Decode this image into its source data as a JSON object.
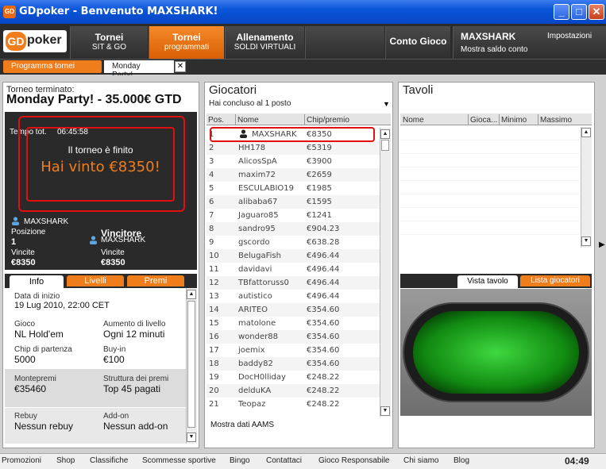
{
  "window": {
    "title": "GDpoker - Benvenuto MAXSHARK!",
    "app_icon": "GD"
  },
  "logo": {
    "gd": "GD",
    "poker": "poker"
  },
  "nav": [
    {
      "l1": "Tornei",
      "l2": "SIT & GO"
    },
    {
      "l1": "Tornei",
      "l2": "programmati"
    },
    {
      "l1": "Allenamento",
      "l2": "SOLDI VIRTUALI"
    },
    {
      "l1": "Conto Gioco",
      "l2": ""
    }
  ],
  "account": {
    "user": "MAXSHARK",
    "settings": "Impostazioni",
    "show_balance": "Mostra saldo conto"
  },
  "subtabs": {
    "schedule": "Programma tornei",
    "current": "Monday Party!..."
  },
  "left": {
    "status": "Torneo terminato:",
    "name": "Monday Party! - 35.000€ GTD",
    "time_label": "Tempo tot.",
    "time_value": "06:45:58",
    "finished": "Il torneo è finito",
    "won": "Hai vinto €8350!",
    "player": "MAXSHARK",
    "position_label": "Posizione",
    "position_value": "1",
    "winnings_label": "Vincite",
    "winnings_value": "€8350",
    "winner_label": "Vincitore",
    "winner_name": "MAXSHARK",
    "winner_winnings_label": "Vincite",
    "winner_winnings_value": "€8350",
    "tabs": [
      "Info",
      "Livelli",
      "Premi"
    ],
    "info": {
      "start_label": "Data di inizio",
      "start_value": "19 Lug 2010, 22:00 CET",
      "game_label": "Gioco",
      "game_value": "NL Hold'em",
      "level_label": "Aumento di livello",
      "level_value": "Ogni 12 minuti",
      "chips_label": "Chip di partenza",
      "chips_value": "5000",
      "buyin_label": "Buy-in",
      "buyin_value": "€100",
      "prize_label": "Montepremi",
      "prize_value": "€35460",
      "structure_label": "Struttura dei premi",
      "structure_value": "Top 45 pagati",
      "rebuy_label": "Rebuy",
      "rebuy_value": "Nessun rebuy",
      "addon_label": "Add-on",
      "addon_value": "Nessun add-on"
    }
  },
  "players": {
    "title": "Giocatori",
    "filter": "Hai concluso al 1 posto",
    "columns": [
      "Pos.",
      "Nome",
      "Chip/premio"
    ],
    "rows": [
      [
        "1",
        "MAXSHARK",
        "€8350"
      ],
      [
        "2",
        "HH178",
        "€5319"
      ],
      [
        "3",
        "AlicosSpA",
        "€3900"
      ],
      [
        "4",
        "maxim72",
        "€2659"
      ],
      [
        "5",
        "ESCULABIO19",
        "€1985"
      ],
      [
        "6",
        "alibaba67",
        "€1595"
      ],
      [
        "7",
        "Jaguaro85",
        "€1241"
      ],
      [
        "8",
        "sandro95",
        "€904.23"
      ],
      [
        "9",
        "gscordo",
        "€638.28"
      ],
      [
        "10",
        "BelugaFish",
        "€496.44"
      ],
      [
        "11",
        "davidavi",
        "€496.44"
      ],
      [
        "12",
        "TBfattoruss0",
        "€496.44"
      ],
      [
        "13",
        "autistico",
        "€496.44"
      ],
      [
        "14",
        "ARITEO",
        "€354.60"
      ],
      [
        "15",
        "matolone",
        "€354.60"
      ],
      [
        "16",
        "wonder88",
        "€354.60"
      ],
      [
        "17",
        "joemix",
        "€354.60"
      ],
      [
        "18",
        "baddy82",
        "€354.60"
      ],
      [
        "19",
        "DocH0lliday",
        "€248.22"
      ],
      [
        "20",
        "delduKA",
        "€248.22"
      ],
      [
        "21",
        "Teopaz",
        "€248.22"
      ]
    ],
    "aams": "Mostra dati AAMS"
  },
  "tables": {
    "title": "Tavoli",
    "columns": [
      "Nome",
      "Gioca...",
      "Minimo",
      "Massimo"
    ],
    "view_tabs": [
      "Vista tavolo",
      "Lista giocatori"
    ]
  },
  "footer": {
    "links": [
      "Promozioni",
      "Shop",
      "Classifiche",
      "Scommesse sportive",
      "Bingo",
      "Contattaci",
      "Gioco Responsabile",
      "Chi siamo",
      "Blog"
    ],
    "clock": "04:49"
  },
  "colors": {
    "accent": "#f07d1c",
    "highlight_red": "#e01010",
    "won_text": "#f07d1c"
  }
}
